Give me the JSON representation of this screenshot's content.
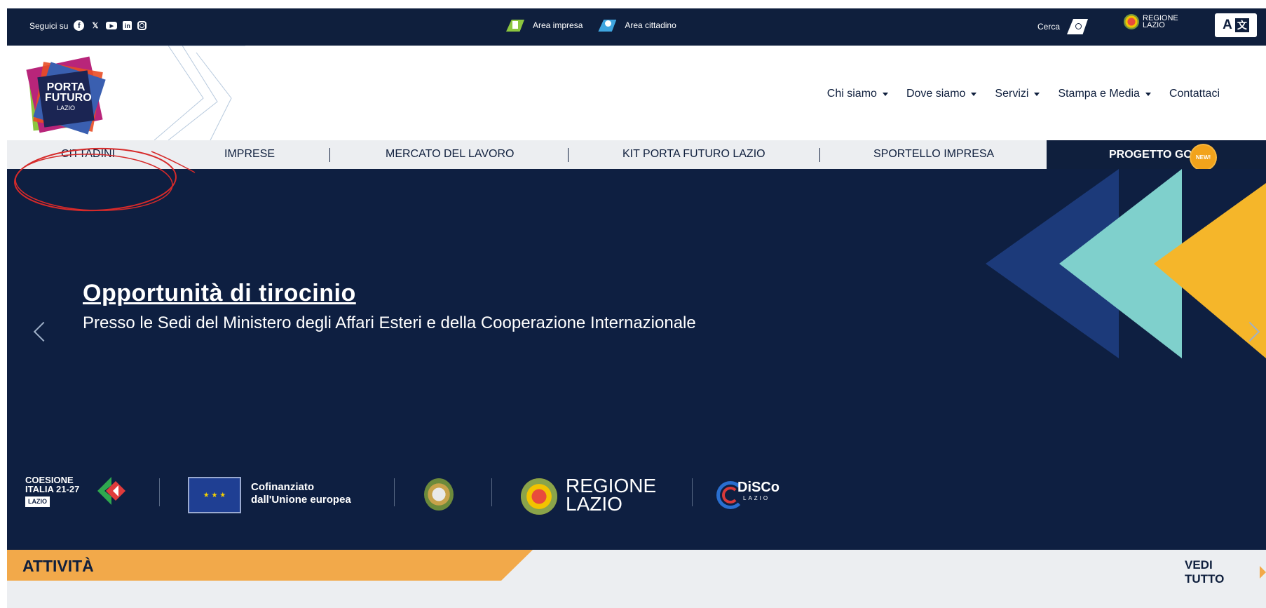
{
  "topbar": {
    "follow_label": "Seguici su",
    "social": [
      "facebook-icon",
      "x-icon",
      "youtube-icon",
      "linkedin-icon",
      "instagram-icon"
    ],
    "area_impresa": "Area impresa",
    "area_cittadino": "Area cittadino",
    "search_label": "Cerca",
    "regione_line1": "REGIONE",
    "regione_line2": "LAZIO",
    "a11y_letter": "A",
    "a11y_glyph": "文"
  },
  "logo": {
    "line1": "PORTA",
    "line2": "FUTURO",
    "line3": "LAZIO"
  },
  "mainnav": {
    "items": [
      "Chi siamo",
      "Dove siamo",
      "Servizi",
      "Stampa e Media",
      "Contattaci"
    ]
  },
  "subnav": {
    "items": [
      "CITTADINI",
      "IMPRESE",
      "MERCATO DEL LAVORO",
      "KIT PORTA FUTURO LAZIO",
      "SPORTELLO IMPRESA"
    ],
    "highlight": "PROGETTO GOL",
    "badge": "NEW!"
  },
  "hero": {
    "title": "Opportunità di tirocinio",
    "subtitle": "Presso le Sedi del Ministero degli Affari Esteri e della Cooperazione Internazionale"
  },
  "partners": {
    "coesione_l1": "COESIONE",
    "coesione_l2": "ITALIA 21-27",
    "coesione_tag": "LAZIO",
    "eu_l1": "Cofinanziato",
    "eu_l2": "dall'Unione europea",
    "regione_l1": "REGIONE",
    "regione_l2": "LAZIO",
    "disco_name": "DiSCo",
    "disco_sub": "LAZIO"
  },
  "activity": {
    "title": "ATTIVITÀ",
    "see_all": "VEDI TUTTO"
  },
  "colors": {
    "navy": "#0f1f3d",
    "orange": "#f2a94a",
    "teal": "#7fd0cc",
    "yellow": "#f5b62a"
  }
}
